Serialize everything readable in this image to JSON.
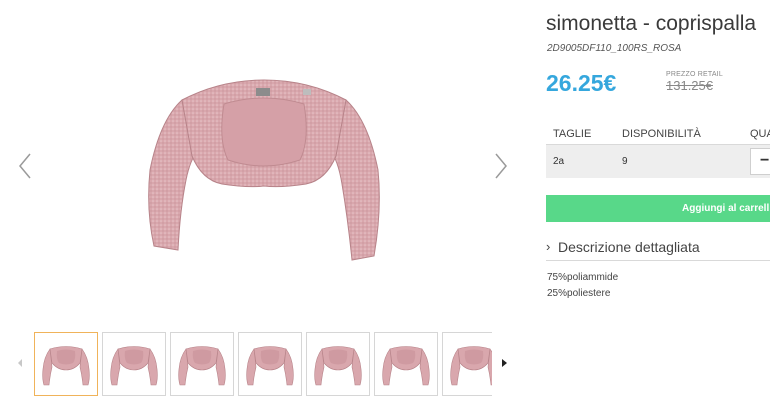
{
  "product": {
    "title": "simonetta - coprispalla",
    "code": "2D9005DF110_100RS_ROSA",
    "price": "26.25€",
    "retail_label": "PREZZO RETAIL",
    "retail_price": "131.25€"
  },
  "colors": {
    "price": "#35a7dd",
    "cart_button": "#58d889",
    "garment_pink": "#d9a7ad",
    "thumb_active_border": "#f0b35a"
  },
  "table": {
    "headers": [
      "TAGLIE",
      "DISPONIBILITÀ",
      "QUA"
    ],
    "row": {
      "size": "2a",
      "availability": "9",
      "qty_symbol": "−"
    }
  },
  "cart": {
    "label": "Aggiungi al carrell"
  },
  "description": {
    "chevron": "›",
    "title": "Descrizione dettagliata",
    "lines": [
      "75%poliammide",
      "25%poliestere"
    ]
  },
  "gallery": {
    "prev_icon": "chevron-left-icon",
    "next_icon": "chevron-right-icon",
    "thumbnail_count": 7,
    "active_thumbnail": 1
  }
}
